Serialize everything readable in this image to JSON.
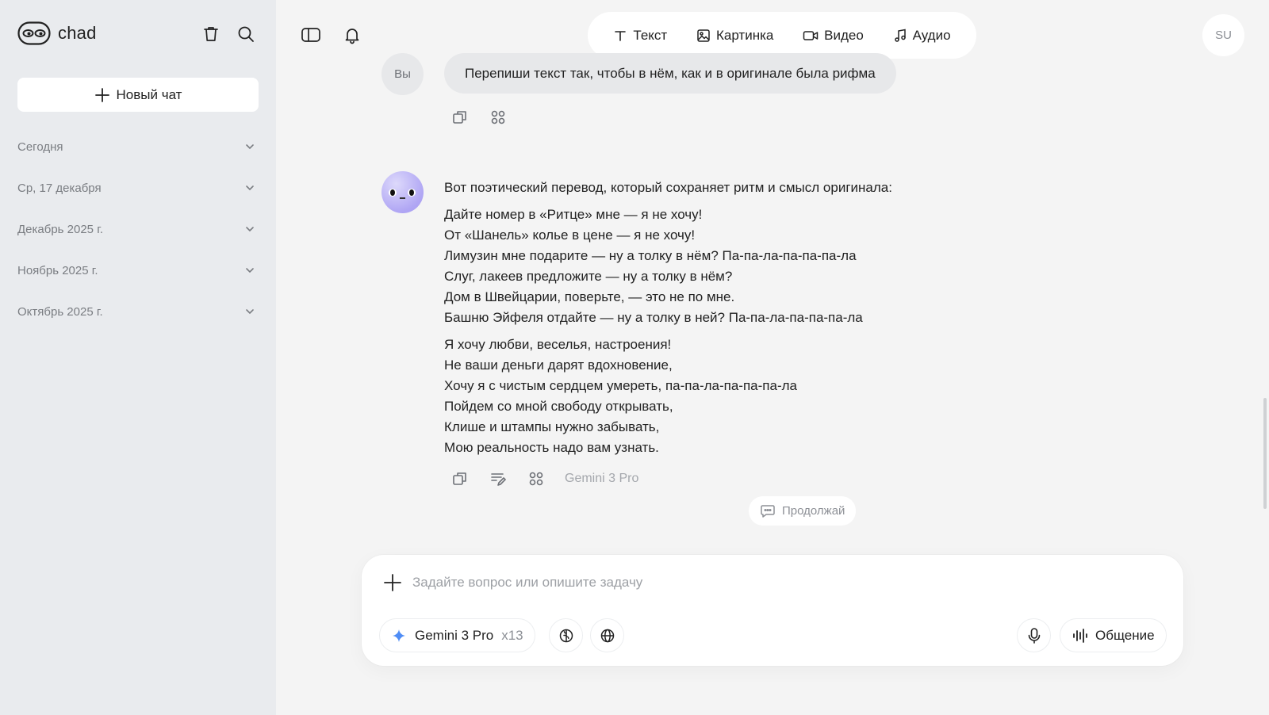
{
  "app": {
    "name": "chad"
  },
  "sidebar": {
    "new_chat_label": "Новый чат",
    "groups": [
      {
        "label": "Сегодня"
      },
      {
        "label": "Ср, 17 декабря"
      },
      {
        "label": "Декабрь 2025 г."
      },
      {
        "label": "Ноябрь 2025 г."
      },
      {
        "label": "Октябрь 2025 г."
      }
    ]
  },
  "topbar": {
    "modes": [
      {
        "label": "Текст",
        "icon": "text-icon"
      },
      {
        "label": "Картинка",
        "icon": "image-icon"
      },
      {
        "label": "Видео",
        "icon": "video-icon"
      },
      {
        "label": "Аудио",
        "icon": "music-note-icon"
      }
    ],
    "user_initials": "SU"
  },
  "conversation": {
    "user_message": {
      "author_label": "Вы",
      "text": "Перепиши текст так, чтобы в нём, как и в оригинале была рифма"
    },
    "assistant_message": {
      "intro": "Вот поэтический перевод, который сохраняет ритм и смысл оригинала:",
      "stanzas": [
        [
          "Дайте номер в «Ритце» мне — я не хочу!",
          "От «Шанель» колье в цене — я не хочу!",
          "Лимузин мне подарите — ну а толку в нём? Па-па-ла-па-па-па-ла",
          "Слуг, лакеев предложите — ну а толку в нём?",
          "Дом в Швейцарии, поверьте, — это не по мне.",
          "Башню Эйфеля отдайте — ну а толку в ней? Па-па-ла-па-па-па-ла"
        ],
        [
          "Я хочу любви, веселья, настроения!",
          "Не ваши деньги дарят вдохновение,",
          "Хочу я с чистым сердцем умереть, па-па-ла-па-па-па-ла",
          "Пойдем со мной свободу открывать,",
          "Клише и штампы нужно забывать,",
          "Мою реальность надо вам узнать."
        ]
      ],
      "model": "Gemini 3 Pro"
    },
    "continue_label": "Продолжай"
  },
  "composer": {
    "placeholder": "Задайте вопрос или опишите задачу",
    "model_name": "Gemini 3 Pro",
    "model_count": "x13",
    "voice_label": "Общение"
  },
  "colors": {
    "sidebar_bg": "#e9ebee",
    "page_bg": "#f4f4f4",
    "bubble_bg": "#e7e8ea",
    "bot_avatar": "#b0a6f4",
    "gemini_accent": "#4f8df6"
  }
}
